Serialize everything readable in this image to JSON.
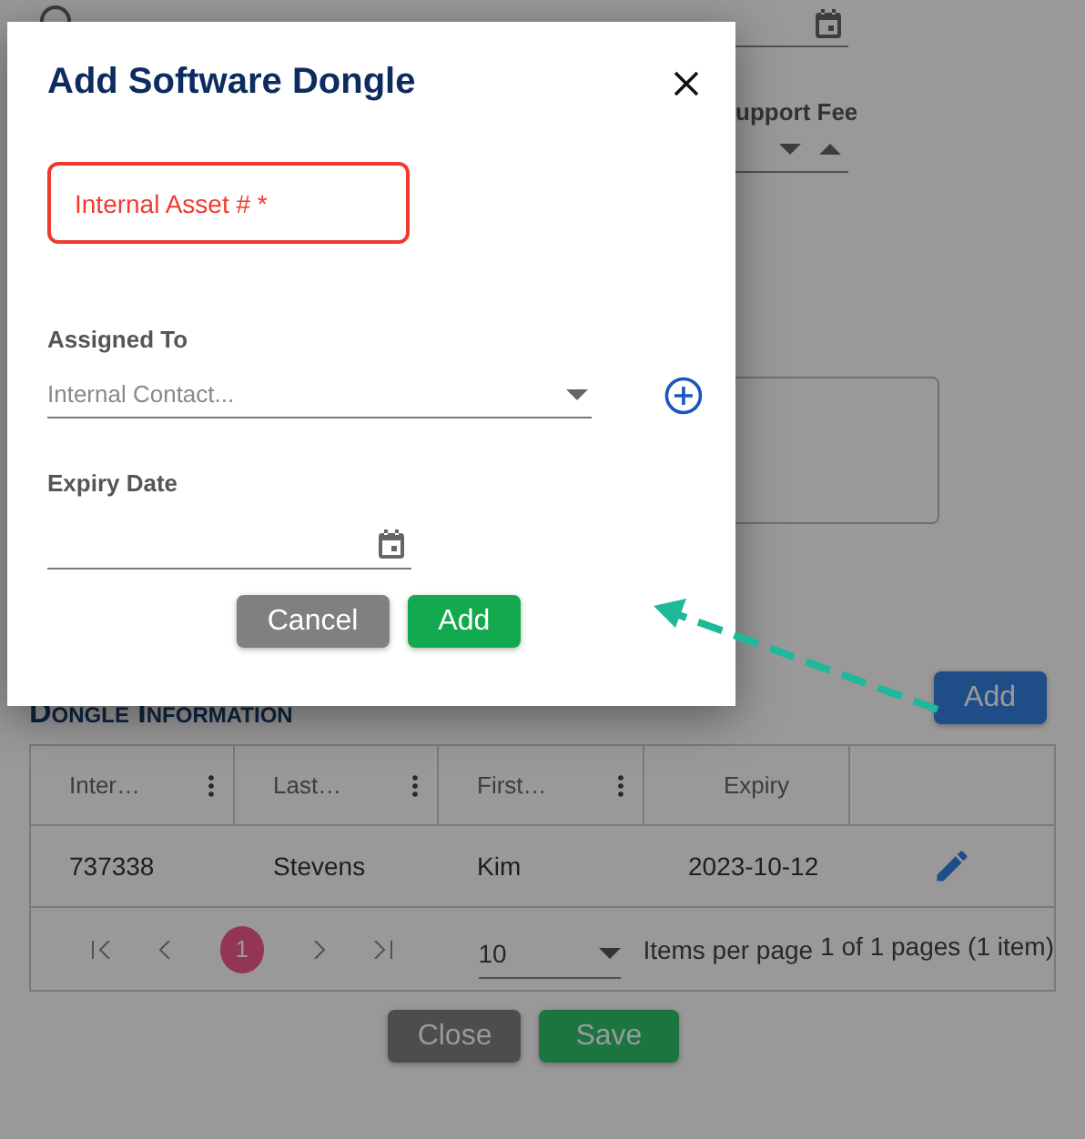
{
  "background_form": {
    "fee_label": "upport Fee"
  },
  "dongle_section": {
    "title": "Dongle Information",
    "add_button": "Add",
    "columns": [
      {
        "label": "Inter…",
        "menu": true
      },
      {
        "label": "Last…",
        "menu": true
      },
      {
        "label": "First…",
        "menu": true
      },
      {
        "label": "Expiry",
        "menu": false
      }
    ],
    "rows": [
      {
        "cells": [
          "737338",
          "Stevens",
          "Kim",
          "2023-10-12"
        ],
        "editable": true
      }
    ],
    "pager": {
      "pages": [
        {
          "label": "1",
          "selected": true
        }
      ],
      "page_size": "10",
      "page_size_label": "Items per page",
      "summary": "1 of 1 pages (1 item)"
    }
  },
  "footer_buttons": [
    {
      "label": "Close",
      "kind": "secondary"
    },
    {
      "label": "Save",
      "kind": "primary"
    }
  ],
  "dialog": {
    "title": "Add Software Dongle",
    "asset_field": {
      "placeholder": "Internal Asset # *",
      "invalid": true
    },
    "assigned_label": "Assigned To",
    "contact_select": {
      "placeholder": "Internal Contact..."
    },
    "expiry_label": "Expiry Date",
    "buttons": [
      {
        "label": "Cancel",
        "kind": "secondary"
      },
      {
        "label": "Add",
        "kind": "primary"
      }
    ]
  }
}
